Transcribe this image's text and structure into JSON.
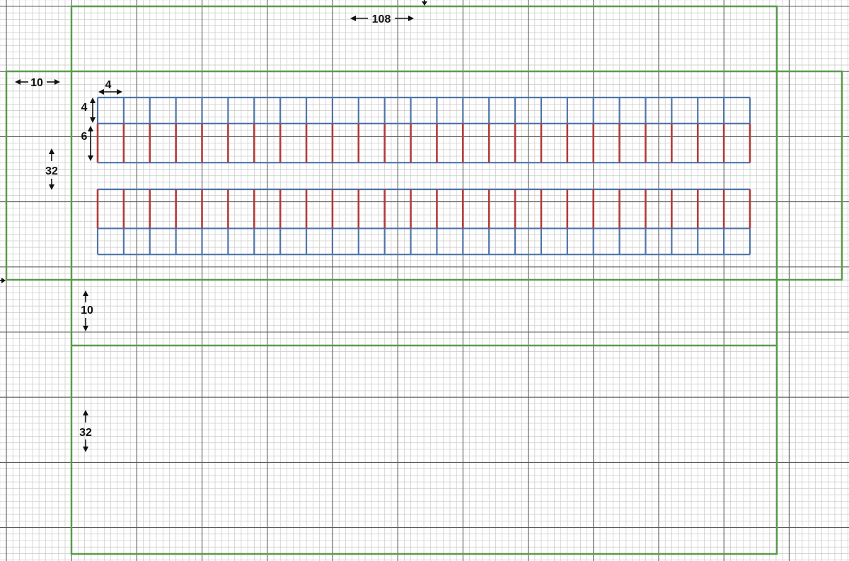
{
  "dimensions": {
    "width_top": "108",
    "margin_left": "10",
    "cell_width": "4",
    "cell_height": "4",
    "post_height": "6",
    "section_height": "32",
    "gap_height": "10",
    "lower_height": "32"
  },
  "colors": {
    "grid_minor": "#c8c8c8",
    "grid_major": "#5a5a5a",
    "outline": "#5a9a4a",
    "cell": "#4f74a8",
    "post": "#b23a3a",
    "arrow": "#111111"
  },
  "pattern": {
    "units_per_cell": 4,
    "cells_per_row": 25,
    "strips": 2
  }
}
